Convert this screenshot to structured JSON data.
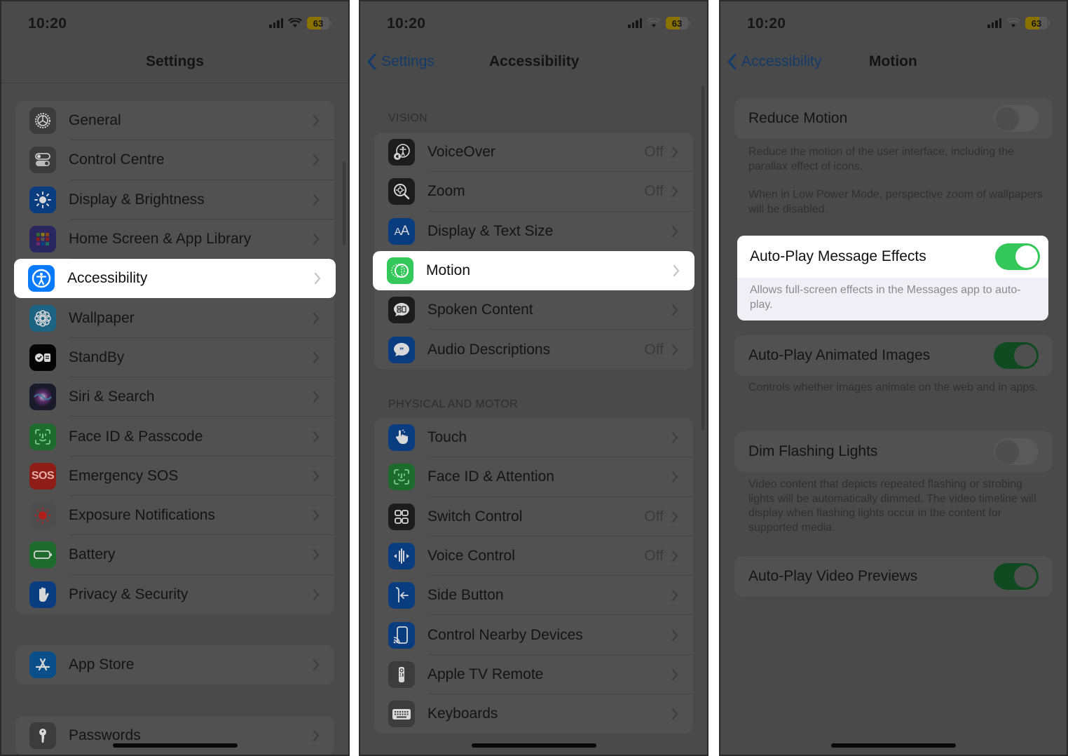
{
  "status_bar": {
    "time": "10:20",
    "battery_percent": 63,
    "battery_label": "63"
  },
  "panels": [
    {
      "nav": {
        "title": "Settings"
      },
      "groups": [
        [
          {
            "label": "General",
            "icon": "gear-icon",
            "icon_bg": "#3c3c3c"
          },
          {
            "label": "Control Centre",
            "icon": "toggles-icon",
            "icon_bg": "#3c3c3c"
          },
          {
            "label": "Display & Brightness",
            "icon": "sun-icon",
            "icon_bg": "#0a3d80"
          },
          {
            "label": "Home Screen & App Library",
            "icon": "app-grid-icon",
            "icon_bg": "#2a2660"
          },
          {
            "label": "Accessibility",
            "icon": "accessibility-icon",
            "icon_bg": "#0a7aff",
            "highlighted": true
          },
          {
            "label": "Wallpaper",
            "icon": "flower-icon",
            "icon_bg": "#1d6384"
          },
          {
            "label": "StandBy",
            "icon": "standby-icon",
            "icon_bg": "#050505"
          },
          {
            "label": "Siri & Search",
            "icon": "siri-icon",
            "icon_bg": "#1a1a2a"
          },
          {
            "label": "Face ID & Passcode",
            "icon": "faceid-icon",
            "icon_bg": "#1e6b2e"
          },
          {
            "label": "Emergency SOS",
            "icon": "sos-icon",
            "icon_bg": "#8e1d18"
          },
          {
            "label": "Exposure Notifications",
            "icon": "exposure-icon",
            "icon_bg": "#4e4e4e"
          },
          {
            "label": "Battery",
            "icon": "battery-icon",
            "icon_bg": "#1e6b2e"
          },
          {
            "label": "Privacy & Security",
            "icon": "hand-icon",
            "icon_bg": "#0a3d80"
          }
        ],
        [
          {
            "label": "App Store",
            "icon": "appstore-icon",
            "icon_bg": "#0a4f8a"
          }
        ],
        [
          {
            "label": "Passwords",
            "icon": "key-icon",
            "icon_bg": "#3c3c3c"
          }
        ]
      ]
    },
    {
      "nav": {
        "title": "Accessibility",
        "back_label": "Settings"
      },
      "sections": [
        {
          "header": "VISION",
          "rows": [
            {
              "label": "VoiceOver",
              "value": "Off",
              "icon": "voiceover-icon",
              "icon_bg": "#1c1c1c"
            },
            {
              "label": "Zoom",
              "value": "Off",
              "icon": "zoom-icon",
              "icon_bg": "#1c1c1c"
            },
            {
              "label": "Display & Text Size",
              "value": "",
              "icon": "text-size-icon",
              "icon_bg": "#0a3d80"
            },
            {
              "label": "Motion",
              "value": "",
              "icon": "motion-icon",
              "icon_bg": "#34c759",
              "highlighted": true
            },
            {
              "label": "Spoken Content",
              "value": "",
              "icon": "spoken-content-icon",
              "icon_bg": "#1c1c1c"
            },
            {
              "label": "Audio Descriptions",
              "value": "Off",
              "icon": "audio-descriptions-icon",
              "icon_bg": "#0a3d80"
            }
          ]
        },
        {
          "header": "PHYSICAL AND MOTOR",
          "rows": [
            {
              "label": "Touch",
              "value": "",
              "icon": "touch-icon",
              "icon_bg": "#0a3d80"
            },
            {
              "label": "Face ID & Attention",
              "value": "",
              "icon": "faceid-icon",
              "icon_bg": "#1e6b2e"
            },
            {
              "label": "Switch Control",
              "value": "Off",
              "icon": "switch-control-icon",
              "icon_bg": "#1c1c1c"
            },
            {
              "label": "Voice Control",
              "value": "Off",
              "icon": "voice-control-icon",
              "icon_bg": "#0a3d80"
            },
            {
              "label": "Side Button",
              "value": "",
              "icon": "side-button-icon",
              "icon_bg": "#0a3d80"
            },
            {
              "label": "Control Nearby Devices",
              "value": "",
              "icon": "nearby-devices-icon",
              "icon_bg": "#0a3d80"
            },
            {
              "label": "Apple TV Remote",
              "value": "",
              "icon": "tv-remote-icon",
              "icon_bg": "#3c3c3c"
            },
            {
              "label": "Keyboards",
              "value": "",
              "icon": "keyboard-icon",
              "icon_bg": "#3c3c3c"
            }
          ]
        }
      ]
    },
    {
      "nav": {
        "title": "Motion",
        "back_label": "Accessibility"
      },
      "settings": [
        {
          "label": "Reduce Motion",
          "on": false,
          "footnotes": [
            "Reduce the motion of the user interface, including the parallax effect of icons.",
            "When in Low Power Mode, perspective zoom of wallpapers will be disabled."
          ]
        },
        {
          "label": "Auto-Play Message Effects",
          "on": true,
          "highlighted": true,
          "footnotes": [
            "Allows full-screen effects in the Messages app to auto-play."
          ]
        },
        {
          "label": "Auto-Play Animated Images",
          "on": true,
          "footnotes": [
            "Controls whether images animate on the web and in apps."
          ]
        },
        {
          "label": "Dim Flashing Lights",
          "on": false,
          "footnotes": [
            "Video content that depicts repeated flashing or strobing lights will be automatically dimmed. The video timeline will display when flashing lights occur in the content for supported media."
          ]
        },
        {
          "label": "Auto-Play Video Previews",
          "on": true,
          "footnotes": []
        }
      ]
    }
  ],
  "colors": {
    "accent_blue": "#0a7aff",
    "toggle_green": "#34c759",
    "dim_overlay": "#4a4a4a"
  }
}
